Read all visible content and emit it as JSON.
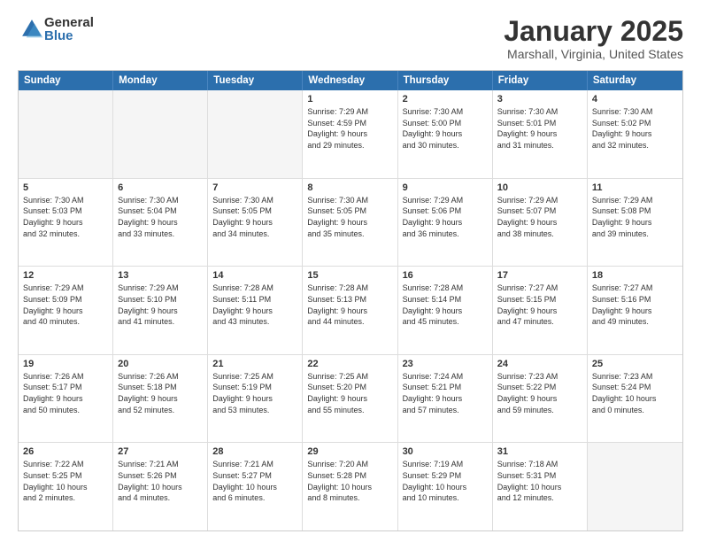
{
  "logo": {
    "general": "General",
    "blue": "Blue"
  },
  "title": {
    "month": "January 2025",
    "location": "Marshall, Virginia, United States"
  },
  "header": {
    "days": [
      "Sunday",
      "Monday",
      "Tuesday",
      "Wednesday",
      "Thursday",
      "Friday",
      "Saturday"
    ]
  },
  "weeks": [
    [
      {
        "day": "",
        "content": ""
      },
      {
        "day": "",
        "content": ""
      },
      {
        "day": "",
        "content": ""
      },
      {
        "day": "1",
        "content": "Sunrise: 7:29 AM\nSunset: 4:59 PM\nDaylight: 9 hours\nand 29 minutes."
      },
      {
        "day": "2",
        "content": "Sunrise: 7:30 AM\nSunset: 5:00 PM\nDaylight: 9 hours\nand 30 minutes."
      },
      {
        "day": "3",
        "content": "Sunrise: 7:30 AM\nSunset: 5:01 PM\nDaylight: 9 hours\nand 31 minutes."
      },
      {
        "day": "4",
        "content": "Sunrise: 7:30 AM\nSunset: 5:02 PM\nDaylight: 9 hours\nand 32 minutes."
      }
    ],
    [
      {
        "day": "5",
        "content": "Sunrise: 7:30 AM\nSunset: 5:03 PM\nDaylight: 9 hours\nand 32 minutes."
      },
      {
        "day": "6",
        "content": "Sunrise: 7:30 AM\nSunset: 5:04 PM\nDaylight: 9 hours\nand 33 minutes."
      },
      {
        "day": "7",
        "content": "Sunrise: 7:30 AM\nSunset: 5:05 PM\nDaylight: 9 hours\nand 34 minutes."
      },
      {
        "day": "8",
        "content": "Sunrise: 7:30 AM\nSunset: 5:05 PM\nDaylight: 9 hours\nand 35 minutes."
      },
      {
        "day": "9",
        "content": "Sunrise: 7:29 AM\nSunset: 5:06 PM\nDaylight: 9 hours\nand 36 minutes."
      },
      {
        "day": "10",
        "content": "Sunrise: 7:29 AM\nSunset: 5:07 PM\nDaylight: 9 hours\nand 38 minutes."
      },
      {
        "day": "11",
        "content": "Sunrise: 7:29 AM\nSunset: 5:08 PM\nDaylight: 9 hours\nand 39 minutes."
      }
    ],
    [
      {
        "day": "12",
        "content": "Sunrise: 7:29 AM\nSunset: 5:09 PM\nDaylight: 9 hours\nand 40 minutes."
      },
      {
        "day": "13",
        "content": "Sunrise: 7:29 AM\nSunset: 5:10 PM\nDaylight: 9 hours\nand 41 minutes."
      },
      {
        "day": "14",
        "content": "Sunrise: 7:28 AM\nSunset: 5:11 PM\nDaylight: 9 hours\nand 43 minutes."
      },
      {
        "day": "15",
        "content": "Sunrise: 7:28 AM\nSunset: 5:13 PM\nDaylight: 9 hours\nand 44 minutes."
      },
      {
        "day": "16",
        "content": "Sunrise: 7:28 AM\nSunset: 5:14 PM\nDaylight: 9 hours\nand 45 minutes."
      },
      {
        "day": "17",
        "content": "Sunrise: 7:27 AM\nSunset: 5:15 PM\nDaylight: 9 hours\nand 47 minutes."
      },
      {
        "day": "18",
        "content": "Sunrise: 7:27 AM\nSunset: 5:16 PM\nDaylight: 9 hours\nand 49 minutes."
      }
    ],
    [
      {
        "day": "19",
        "content": "Sunrise: 7:26 AM\nSunset: 5:17 PM\nDaylight: 9 hours\nand 50 minutes."
      },
      {
        "day": "20",
        "content": "Sunrise: 7:26 AM\nSunset: 5:18 PM\nDaylight: 9 hours\nand 52 minutes."
      },
      {
        "day": "21",
        "content": "Sunrise: 7:25 AM\nSunset: 5:19 PM\nDaylight: 9 hours\nand 53 minutes."
      },
      {
        "day": "22",
        "content": "Sunrise: 7:25 AM\nSunset: 5:20 PM\nDaylight: 9 hours\nand 55 minutes."
      },
      {
        "day": "23",
        "content": "Sunrise: 7:24 AM\nSunset: 5:21 PM\nDaylight: 9 hours\nand 57 minutes."
      },
      {
        "day": "24",
        "content": "Sunrise: 7:23 AM\nSunset: 5:22 PM\nDaylight: 9 hours\nand 59 minutes."
      },
      {
        "day": "25",
        "content": "Sunrise: 7:23 AM\nSunset: 5:24 PM\nDaylight: 10 hours\nand 0 minutes."
      }
    ],
    [
      {
        "day": "26",
        "content": "Sunrise: 7:22 AM\nSunset: 5:25 PM\nDaylight: 10 hours\nand 2 minutes."
      },
      {
        "day": "27",
        "content": "Sunrise: 7:21 AM\nSunset: 5:26 PM\nDaylight: 10 hours\nand 4 minutes."
      },
      {
        "day": "28",
        "content": "Sunrise: 7:21 AM\nSunset: 5:27 PM\nDaylight: 10 hours\nand 6 minutes."
      },
      {
        "day": "29",
        "content": "Sunrise: 7:20 AM\nSunset: 5:28 PM\nDaylight: 10 hours\nand 8 minutes."
      },
      {
        "day": "30",
        "content": "Sunrise: 7:19 AM\nSunset: 5:29 PM\nDaylight: 10 hours\nand 10 minutes."
      },
      {
        "day": "31",
        "content": "Sunrise: 7:18 AM\nSunset: 5:31 PM\nDaylight: 10 hours\nand 12 minutes."
      },
      {
        "day": "",
        "content": ""
      }
    ]
  ]
}
